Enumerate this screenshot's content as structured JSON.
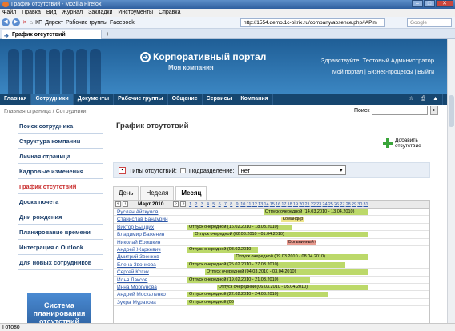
{
  "browser": {
    "title": "График отсутствий - Mozilla Firefox",
    "menu": [
      "Файл",
      "Правка",
      "Вид",
      "Журнал",
      "Закладки",
      "Инструменты",
      "Справка"
    ],
    "bookmarks": [
      "КП",
      "Директ",
      "Рабочие группы",
      "Facebook"
    ],
    "url": "http://1554.demo.1c-bitrix.ru/company/absence.php#AP.m",
    "search_placeholder": "Google",
    "tab_title": "График отсутствий",
    "status": "Готово"
  },
  "portal": {
    "title": "Корпоративный портал",
    "company": "Моя компания",
    "greeting": "Здравствуйте, Тестовый Администратор",
    "links": "Мой портал | Бизнес-процессы | Выйти"
  },
  "topmenu": [
    "Главная",
    "Сотрудники",
    "Документы",
    "Рабочие группы",
    "Общение",
    "Сервисы",
    "Компания"
  ],
  "breadcrumb": "Главная страница / Сотрудники",
  "search_label": "Поиск",
  "sidebar": [
    "Поиск сотрудника",
    "Структура компании",
    "Личная страница",
    "Кадровые изменения",
    "График отсутствий",
    "Доска почета",
    "Дни рождения",
    "Планирование времени",
    "Интеграция с Outlook",
    "Для новых сотрудников"
  ],
  "banner_text": "Система планирования отсутствий",
  "page_title": "График отсутствий",
  "add_button": "Добавить отсутствие",
  "filter": {
    "types_label": "Типы отсутствий:",
    "dept_label": "Подразделение:",
    "dept_value": "нет"
  },
  "view_tabs": [
    "День",
    "Неделя",
    "Месяц"
  ],
  "calendar": {
    "month": "Март 2010",
    "days": [
      "1",
      "2",
      "3",
      "4",
      "5",
      "6",
      "7",
      "8",
      "9",
      "10",
      "11",
      "12",
      "13",
      "14",
      "15",
      "16",
      "17",
      "18",
      "19",
      "20",
      "21",
      "22",
      "23",
      "24",
      "25",
      "26",
      "27",
      "28",
      "29",
      "30",
      "31"
    ]
  },
  "colors": {
    "vacation": "#bcd96a",
    "trip": "#eee58a",
    "sick": "#e89a8e"
  },
  "employees": [
    {
      "name": "Руслан Айткулов",
      "label": "Отпуск очередной (14.03.2010 - 13.04.2010)",
      "kind": "vacation",
      "start": 14,
      "end": 31
    },
    {
      "name": "Станислав Бандурин",
      "label": "Командир",
      "kind": "trip",
      "start": 17,
      "end": 20
    },
    {
      "name": "Виктор Быццих",
      "label": "Отпуск очередной (16.02.2010 - 18.03.2010)",
      "kind": "vacation",
      "start": 1,
      "end": 18
    },
    {
      "name": "Владимир Баженин",
      "label": "Отпуск очередной (02.03.2010 - 01.04.2010)",
      "kind": "vacation",
      "start": 2,
      "end": 31
    },
    {
      "name": "Николай Ерошкин",
      "label": "Больничный (18",
      "kind": "sick",
      "start": 18,
      "end": 22
    },
    {
      "name": "Андрей Жаркевич",
      "label": "Отпуск очередной (08.02.2010 -",
      "kind": "vacation",
      "start": 1,
      "end": 12
    },
    {
      "name": "Дмитрий Звенков",
      "label": "Отпуск очередной (09.03.2010 - 08.04.2010)",
      "kind": "vacation",
      "start": 9,
      "end": 31
    },
    {
      "name": "Елена Звонкова",
      "label": "Отпуск очередной (25.02.2010 - 27.03.2010)",
      "kind": "vacation",
      "start": 1,
      "end": 27
    },
    {
      "name": "Сергей Котик",
      "label": "Отпуск очередной (04.03.2010 - 03.04.2010)",
      "kind": "vacation",
      "start": 4,
      "end": 31
    },
    {
      "name": "Илья Лаксов",
      "label": "Отпуск очередной (19.02.2010 - 21.03.2010)",
      "kind": "vacation",
      "start": 1,
      "end": 21
    },
    {
      "name": "Инна Моргунова",
      "label": "Отпуск очередной (06.03.2010 - 05.04.2010)",
      "kind": "vacation",
      "start": 6,
      "end": 31
    },
    {
      "name": "Андрей Москаленко",
      "label": "Отпуск очередной (22.02.2010 - 24.03.2010)",
      "kind": "vacation",
      "start": 1,
      "end": 24
    },
    {
      "name": "Зухра Муратова",
      "label": "Отпуск очередной (06.02.2",
      "kind": "vacation",
      "start": 1,
      "end": 8
    }
  ]
}
